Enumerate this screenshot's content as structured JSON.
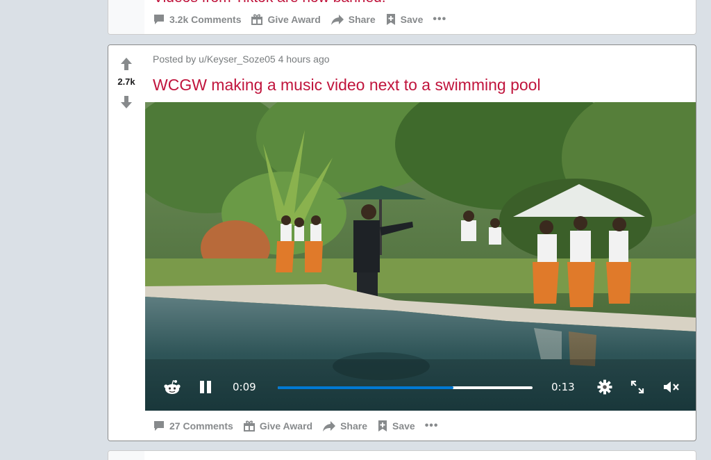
{
  "previous_post": {
    "title_fragment": "Videos from Tiktok are now banned.",
    "actions": {
      "comments": "3.2k Comments",
      "award": "Give Award",
      "share": "Share",
      "save": "Save",
      "more": "•••"
    }
  },
  "post": {
    "score": "2.7k",
    "posted_by_prefix": "Posted by",
    "username": "u/Keyser_Soze05",
    "time_ago": "4 hours ago",
    "title": "WCGW making a music video next to a swimming pool",
    "video": {
      "current_time": "0:09",
      "duration": "0:13",
      "progress_fraction": 0.69,
      "state": "playing",
      "muted": true
    },
    "actions": {
      "comments": "27 Comments",
      "award": "Give Award",
      "share": "Share",
      "save": "Save",
      "more": "•••"
    }
  },
  "icons": {
    "upvote": "arrow-up-icon",
    "downvote": "arrow-down-icon",
    "comments": "comment-bubble-icon",
    "award": "gift-icon",
    "share": "share-arrow-icon",
    "save": "bookmark-plus-icon",
    "reddit": "reddit-alien-icon",
    "pause": "pause-icon",
    "settings": "gear-icon",
    "fullscreen": "expand-icon",
    "mute": "speaker-muted-icon"
  },
  "colors": {
    "title": "#c0143c",
    "meta": "#787c7e",
    "action": "#878a8c",
    "progress": "#0079d3",
    "page_bg": "#dae0e6"
  }
}
